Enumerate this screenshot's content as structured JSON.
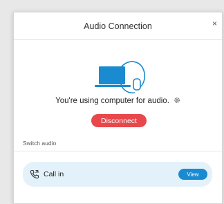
{
  "dialog": {
    "title": "Audio Connection",
    "close_glyph": "×",
    "status_text": "You're using computer for audio.",
    "disconnect_label": "Disconnect",
    "switch_audio_label": "Switch audio",
    "call_in_label": "Call in",
    "view_label": "View"
  },
  "colors": {
    "accent_blue": "#1a8ad1",
    "disconnect_red": "#e8474b",
    "card_background": "#e3f2fa"
  },
  "icons": {
    "illustration": "laptop-headset-icon",
    "settings": "gear-icon",
    "call": "phone-icon"
  }
}
